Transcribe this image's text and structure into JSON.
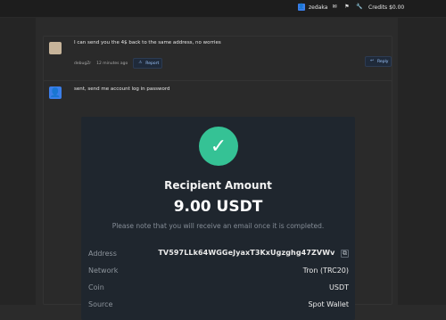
{
  "topbar": {
    "username": "zedaka",
    "credits_label": "Credits $0.00",
    "icons": [
      "user-icon",
      "mail-icon",
      "flag-icon",
      "wrench-icon"
    ]
  },
  "posts": [
    {
      "author": "debugZr",
      "time": "12 minutes ago",
      "text": "I can send you the 4$ back to the same address, no worries",
      "actions": {
        "report_label": "Report",
        "reply_label": "Reply"
      }
    },
    {
      "text": "sent, send me account log in password",
      "receipt": {
        "icon": "check-icon",
        "recipient_label": "Recipient Amount",
        "amount": "9.00 USDT",
        "note": "Please note that you will receive an email once it is completed.",
        "details": [
          {
            "key": "Address",
            "value": "TV597LLk64WGGeJyaxT3KxUgzghg47ZVWv"
          },
          {
            "key": "Network",
            "value": "Tron (TRC20)"
          },
          {
            "key": "Coin",
            "value": "USDT"
          },
          {
            "key": "Source",
            "value": "Spot Wallet"
          }
        ]
      }
    }
  ]
}
